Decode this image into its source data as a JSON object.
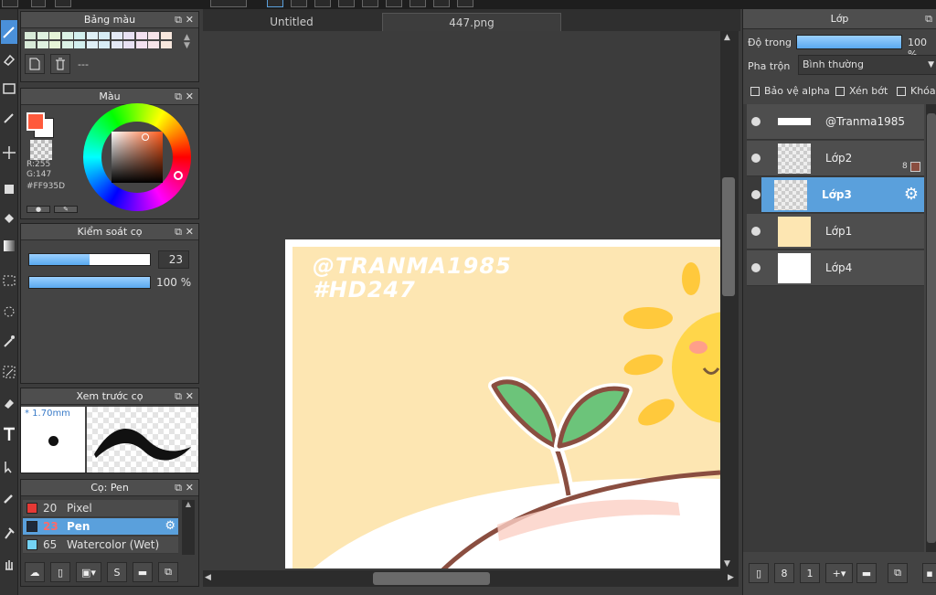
{
  "tabs": {
    "untitled": "Untitled",
    "file": "447.png"
  },
  "palette_panel": {
    "title": "Bảng màu",
    "new_label": "---",
    "swatches": [
      "#d8ead8",
      "#dff1e0",
      "#e6f4d8",
      "#dcf2e6",
      "#d3f0ef",
      "#dff0f7",
      "#d7ecf5",
      "#e4e9f6",
      "#e8e1f3",
      "#f3e1f0",
      "#f6e4e9",
      "#f7e7dd"
    ]
  },
  "color_panel": {
    "title": "Màu",
    "rgb_r": "R:255",
    "rgb_g": "G:147",
    "hex": "#FF935D",
    "fg_color": "#FF5A3C",
    "bg_color": "#FFFFFF"
  },
  "brush_control": {
    "title": "Kiểm soát cọ",
    "size": "23",
    "opacity": "100 %",
    "size_fill": 0.5,
    "opacity_fill": 1.0
  },
  "brush_preview": {
    "title": "Xem trước cọ",
    "size_label": "* 1.70mm"
  },
  "brush_list": {
    "title": "Cọ: Pen",
    "items": [
      {
        "size": "20",
        "name": "Pixel",
        "color": "#e53935"
      },
      {
        "size": "23",
        "name": "Pen",
        "color": "#1f2a3a"
      },
      {
        "size": "65",
        "name": "Watercolor (Wet)",
        "color": "#74d3f5"
      }
    ]
  },
  "canvas": {
    "line1": "@TRANMA1985",
    "line2": "#HD247"
  },
  "layers_panel": {
    "title": "Lớp",
    "opacity_label": "Độ trong",
    "opacity_value": "100 %",
    "blend_label": "Pha trộn",
    "blend_value": "Bình thường",
    "protect_alpha": "Bảo vệ alpha",
    "clipping": "Xén bớt",
    "lock": "Khóa",
    "layers": [
      {
        "name": "@Tranma1985",
        "badge": ""
      },
      {
        "name": "Lớp2",
        "badge": "8"
      },
      {
        "name": "Lớp3",
        "badge": ""
      },
      {
        "name": "Lớp1",
        "badge": ""
      },
      {
        "name": "Lớp4",
        "badge": ""
      }
    ]
  }
}
